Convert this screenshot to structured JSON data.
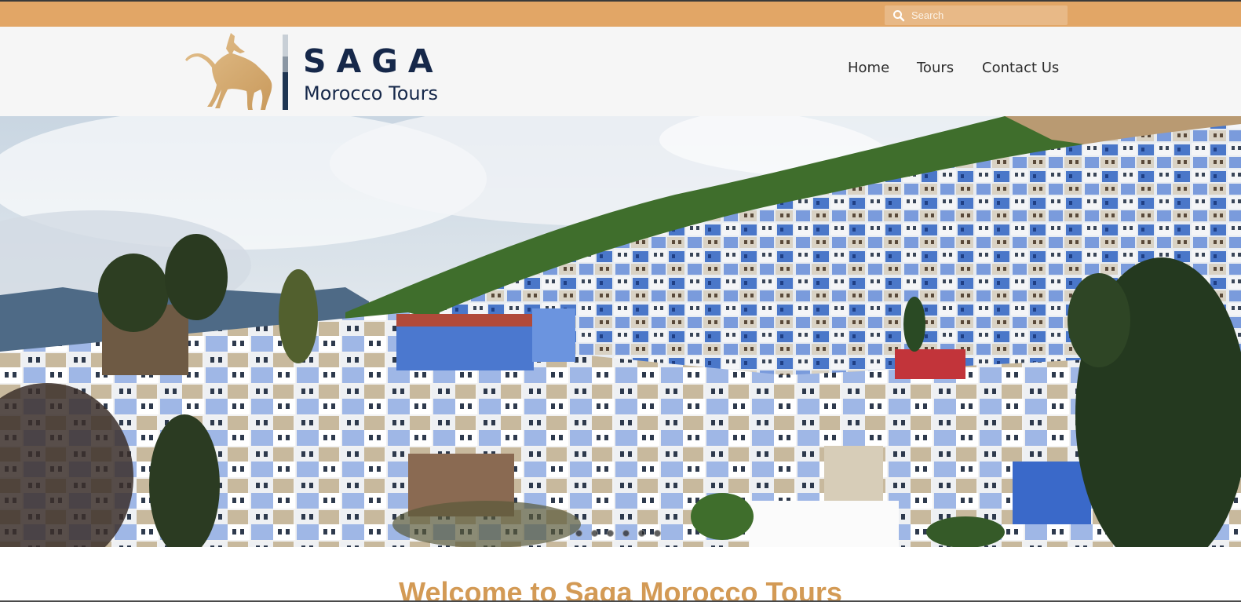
{
  "search": {
    "placeholder": "Search",
    "icon": "search-icon"
  },
  "logo": {
    "title": "SAGA",
    "subtitle": "Morocco Tours",
    "icon": "camel-rider-icon"
  },
  "nav": {
    "items": [
      {
        "label": "Home"
      },
      {
        "label": "Tours"
      },
      {
        "label": "Contact Us"
      }
    ]
  },
  "hero": {
    "slides_count": 6,
    "active_slide": 1
  },
  "main": {
    "welcome_heading": "Welcome to Saga Morocco Tours"
  },
  "colors": {
    "topbar": "#e2a666",
    "header_bg": "#f6f6f6",
    "brand_navy": "#16284a",
    "brand_gold": "#d0a66a",
    "heading_gold": "#d39a55"
  }
}
